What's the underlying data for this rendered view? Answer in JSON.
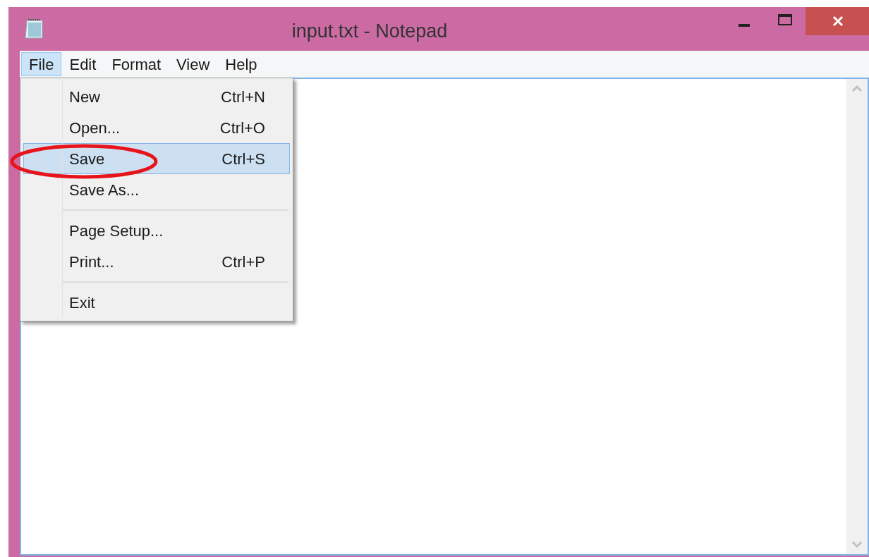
{
  "window": {
    "title": "input.txt - Notepad"
  },
  "menu_bar": [
    {
      "label": "File",
      "selected": true
    },
    {
      "label": "Edit",
      "selected": false
    },
    {
      "label": "Format",
      "selected": false
    },
    {
      "label": "View",
      "selected": false
    },
    {
      "label": "Help",
      "selected": false
    }
  ],
  "file_menu": [
    {
      "kind": "item",
      "label": "New",
      "shortcut": "Ctrl+N",
      "selected": false
    },
    {
      "kind": "item",
      "label": "Open...",
      "shortcut": "Ctrl+O",
      "selected": false
    },
    {
      "kind": "item",
      "label": "Save",
      "shortcut": "Ctrl+S",
      "selected": true
    },
    {
      "kind": "item",
      "label": "Save As...",
      "selected": false
    },
    {
      "kind": "separator"
    },
    {
      "kind": "item",
      "label": "Page Setup...",
      "selected": false
    },
    {
      "kind": "item",
      "label": "Print...",
      "shortcut": "Ctrl+P",
      "selected": false
    },
    {
      "kind": "separator"
    },
    {
      "kind": "item",
      "label": "Exit",
      "selected": false
    }
  ],
  "annotation": {
    "kind": "ellipse"
  }
}
